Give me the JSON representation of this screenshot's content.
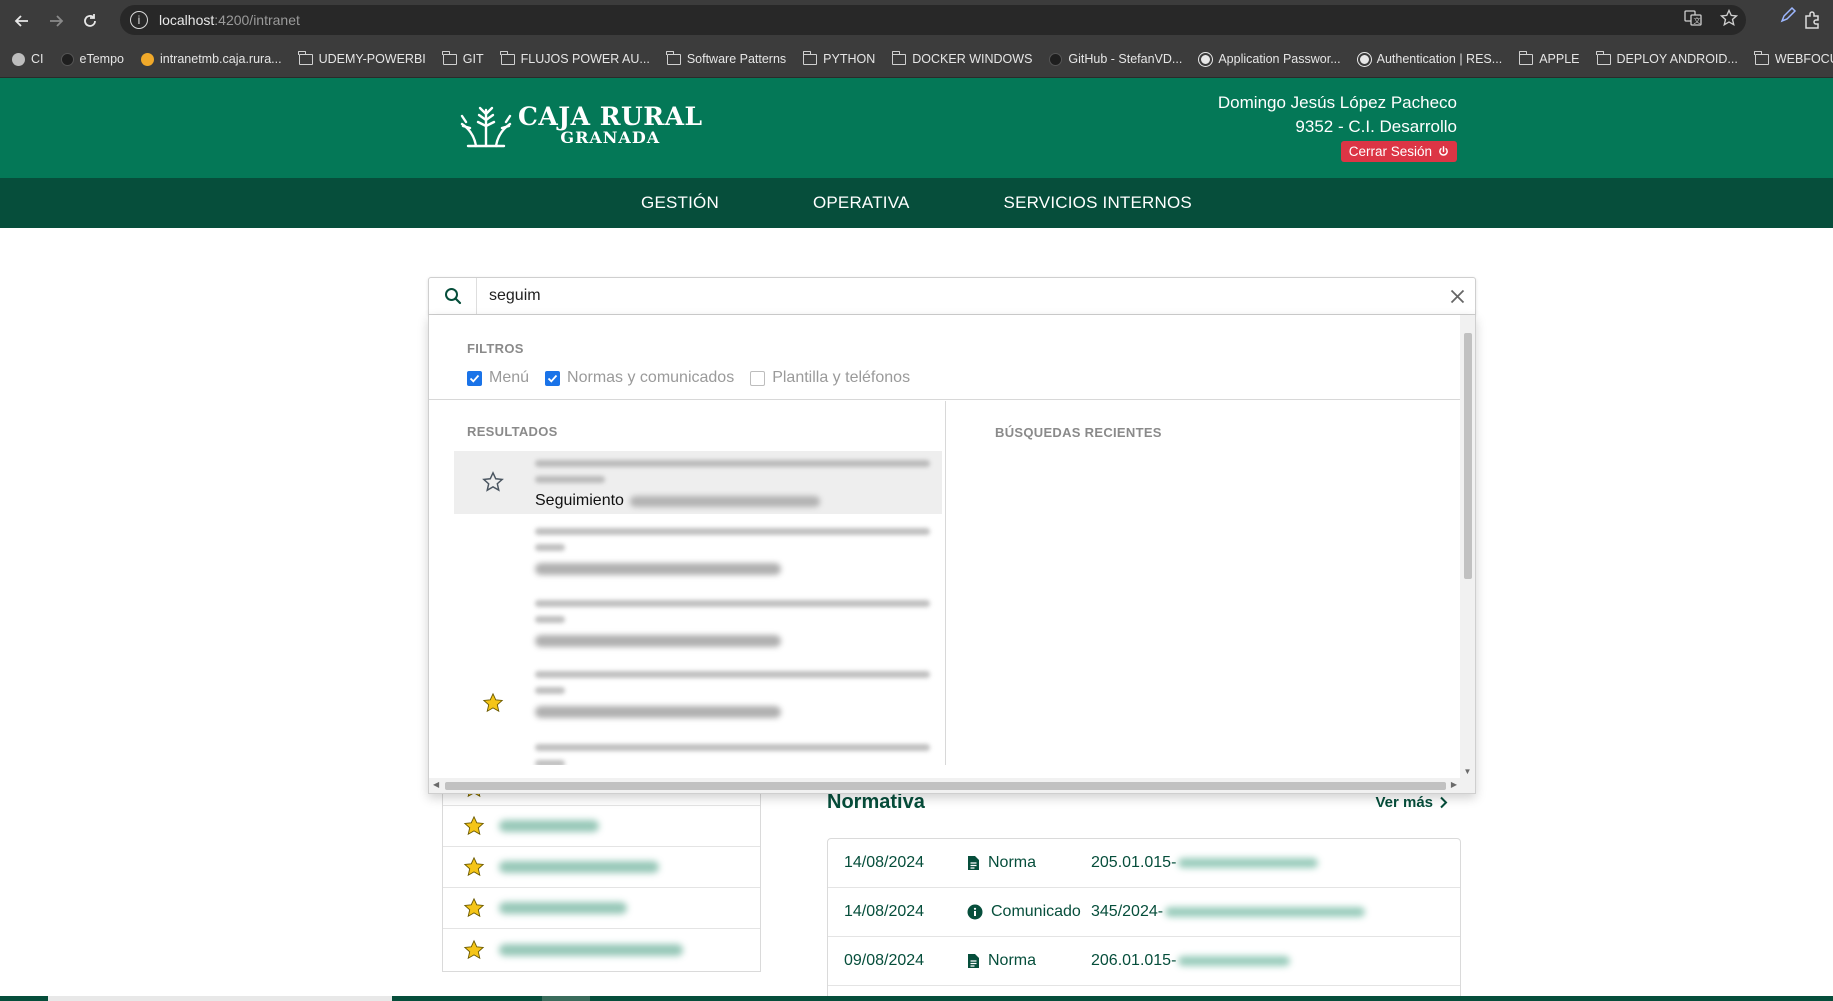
{
  "browser": {
    "url_host": "localhost",
    "url_path": ":4200/intranet",
    "bookmarks": [
      {
        "label": "CI",
        "icon": "globe-icon"
      },
      {
        "label": "eTempo",
        "icon": "clock-icon"
      },
      {
        "label": "intranetmb.caja.rura...",
        "icon": "site-icon"
      },
      {
        "label": "UDEMY-POWERBI",
        "icon": "folder-icon"
      },
      {
        "label": "GIT",
        "icon": "folder-icon"
      },
      {
        "label": "FLUJOS POWER AU...",
        "icon": "folder-icon"
      },
      {
        "label": "Software Patterns",
        "icon": "folder-icon"
      },
      {
        "label": "PYTHON",
        "icon": "folder-icon"
      },
      {
        "label": "DOCKER WINDOWS",
        "icon": "folder-icon"
      },
      {
        "label": "GitHub - StefanVD...",
        "icon": "github-icon"
      },
      {
        "label": "Application Passwor...",
        "icon": "wordpress-icon"
      },
      {
        "label": "Authentication | RES...",
        "icon": "wordpress-icon"
      },
      {
        "label": "APPLE",
        "icon": "folder-icon"
      },
      {
        "label": "DEPLOY ANDROID...",
        "icon": "folder-icon"
      },
      {
        "label": "WEBFOCUS",
        "icon": "folder-icon"
      }
    ]
  },
  "header": {
    "logo_line1": "CAJA RURAL",
    "logo_line2": "GRANADA",
    "user_name": "Domingo Jesús López Pacheco",
    "user_dept": "9352 - C.I. Desarrollo",
    "logout_label": "Cerrar Sesión"
  },
  "nav": {
    "items": [
      "GESTIÓN",
      "OPERATIVA",
      "SERVICIOS INTERNOS"
    ]
  },
  "search": {
    "value": "seguim",
    "filters_label": "FILTROS",
    "filters": [
      {
        "label": "Menú",
        "checked": true
      },
      {
        "label": "Normas y comunicados",
        "checked": true
      },
      {
        "label": "Plantilla y teléfonos",
        "checked": false
      }
    ],
    "results_label": "RESULTADOS",
    "recent_label": "BÚSQUEDAS RECIENTES",
    "results": [
      {
        "title": "Seguimiento",
        "favorite": false,
        "selected": true
      },
      {
        "title": "",
        "favorite": false,
        "selected": false
      },
      {
        "title": "",
        "favorite": false,
        "selected": false
      },
      {
        "title": "",
        "favorite": true,
        "selected": false
      },
      {
        "title": "",
        "favorite": false,
        "selected": false
      }
    ]
  },
  "normativa": {
    "title": "Normativa",
    "ver_mas": "Ver más",
    "rows": [
      {
        "date": "14/08/2024",
        "type": "Norma",
        "icon": "document-icon",
        "code": "205.01.015-"
      },
      {
        "date": "14/08/2024",
        "type": "Comunicado",
        "icon": "info-icon",
        "code": "345/2024-"
      },
      {
        "date": "09/08/2024",
        "type": "Norma",
        "icon": "document-icon",
        "code": "206.01.015-"
      }
    ]
  },
  "colors": {
    "header_green": "#047857",
    "nav_green": "#064e3b",
    "logout_red": "#dc3545",
    "checkbox_blue": "#1a73e8",
    "star_gold": "#f5c518"
  }
}
